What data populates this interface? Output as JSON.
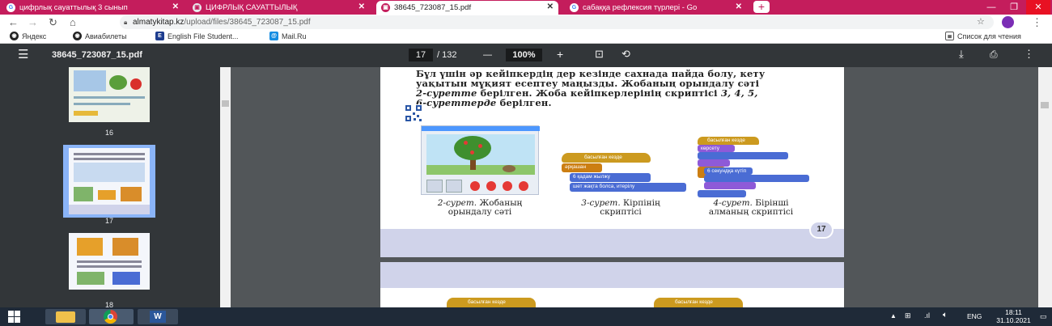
{
  "browser": {
    "tabs": [
      {
        "title": "цифрлық сауаттылық 3 сынып",
        "favicon": "google-icon"
      },
      {
        "title": "ЦИФРЛЫҚ САУАТТЫЛЫҚ",
        "favicon": "pdf-icon"
      },
      {
        "title": "38645_723087_15.pdf",
        "favicon": "pdf-icon"
      },
      {
        "title": "сабаққа рефлексия түрлері - Go",
        "favicon": "google-icon"
      }
    ],
    "new_tab": "+",
    "url_domain": "almatykitap.kz",
    "url_path": "/upload/files/38645_723087_15.pdf",
    "bookmarks": [
      "Яндекс",
      "Авиабилеты",
      "English File Student...",
      "Mail.Ru"
    ],
    "reading_list": "Список для чтения"
  },
  "pdf": {
    "filename": "38645_723087_15.pdf",
    "current_page": "17",
    "total_pages": "/ 132",
    "zoom": "100%",
    "zoom_minus": "—",
    "zoom_plus": "+"
  },
  "thumbnails": [
    {
      "num": "16"
    },
    {
      "num": "17"
    },
    {
      "num": "18"
    }
  ],
  "page": {
    "line1": "Бұл үшін әр кейіпкердің дер кезінде сахнада пайда болу, кету",
    "line2": "уақытын мұқият есептеу маңызды. Жобаның орындалу сәті",
    "line3a": "2-суретте",
    "line3b": " берілген. Жоба кейіпкерлерінің скриптісі ",
    "line3c": "3, 4, 5,",
    "line4a": "6-суреттерде",
    "line4b": " берілген.",
    "cap2a": "2-сурет.",
    "cap2b": " Жобаның",
    "cap2c": "орындалу сәті",
    "cap3a": "3-сурет.",
    "cap3b": " Кірпінің",
    "cap3c": "скриптісі",
    "cap4a": "4-сурет.",
    "cap4b": " Бірінші",
    "cap4c": "алманың скриптісі",
    "page_number": "17",
    "blocks3": [
      "басылған кезде",
      "әрқашан",
      "6 қадам жылжу",
      "шет жақта болса, итерілу"
    ],
    "blocks4": [
      "басылған кезде",
      "көрсету",
      "6 секундқа күтіп",
      "басылған кезде",
      "басылған кезде"
    ]
  },
  "taskbar": {
    "lang": "ENG",
    "time": "18:11",
    "date": "31.10.2021"
  },
  "colors": {
    "tabbar": "#c41d5c",
    "pdf_toolbar": "#323639",
    "scratch_event": "#cc9a1f",
    "scratch_motion": "#4a6cd4"
  }
}
